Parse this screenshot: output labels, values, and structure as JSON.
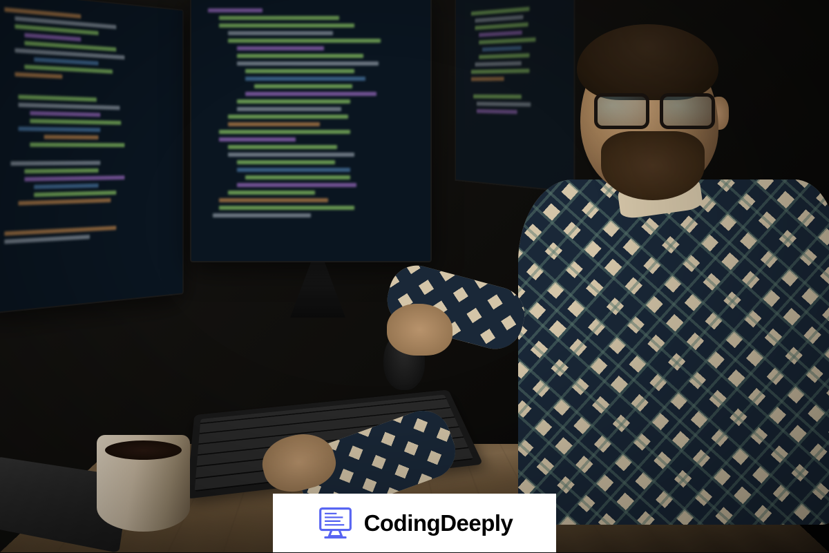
{
  "logo": {
    "text": "CodingDeeply",
    "icon_color": "#5865F2"
  },
  "scene": {
    "description": "Bearded man with glasses in plaid shirt coding at dual monitors with keyboard, mouse and coffee cup on wooden desk at night",
    "colors": {
      "screen_bg": "#0a1520",
      "code_green": "#8cc864",
      "code_purple": "#b478dc",
      "desk_wood": "#7a6244",
      "shirt_light": "#d4c5a8",
      "shirt_dark": "#1a2838"
    }
  }
}
